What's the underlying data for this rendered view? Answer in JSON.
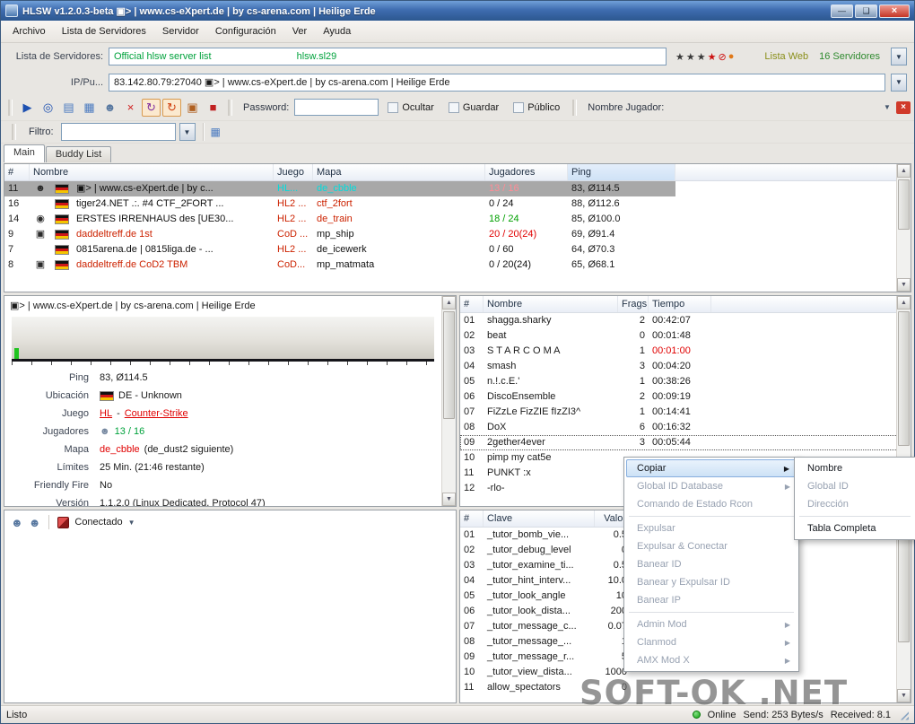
{
  "colors": {
    "accent_green": "#00a23c",
    "alert_red": "#e00000",
    "map_cyan": "#00dcdc",
    "selection_gray": "#a8a8a8",
    "header_blue": "#cfe2f6"
  },
  "window": {
    "title": "HLSW v1.2.0.3-beta   ▣> | www.cs-eXpert.de | by cs-arena.com | Heilige Erde",
    "controls": {
      "minimize": "—",
      "maximize": "❑",
      "close": "×"
    }
  },
  "menubar": {
    "items": [
      "Archivo",
      "Lista de Servidores",
      "Servidor",
      "Configuración",
      "Ver",
      "Ayuda"
    ]
  },
  "server_list_bar": {
    "label": "Lista de Servidores:",
    "list_name": "Official hlsw server list",
    "list_code": "hlsw.sl29",
    "icons": [
      {
        "name": "star-icon",
        "glyph": "★",
        "color": "#3a3a3a"
      },
      {
        "name": "star-icon",
        "glyph": "★",
        "color": "#3a3a3a"
      },
      {
        "name": "star-icon",
        "glyph": "★",
        "color": "#3a3a3a"
      },
      {
        "name": "red-star-icon",
        "glyph": "★",
        "color": "#cc1111"
      },
      {
        "name": "ban-icon",
        "glyph": "⊘",
        "color": "#cc1111"
      },
      {
        "name": "fireball-icon",
        "glyph": "●",
        "color": "#e07818"
      }
    ],
    "web_label": "Lista Web",
    "count_label": "16 Servidores"
  },
  "address_bar": {
    "label": "IP/Pu...",
    "value": "83.142.80.79:27040  ▣> | www.cs-eXpert.de | by cs-arena.com | Heilige Erde"
  },
  "toolbar": {
    "icons": [
      {
        "name": "connect-icon",
        "glyph": "▶",
        "color": "#1d50b0"
      },
      {
        "name": "search-server-icon",
        "glyph": "◎",
        "color": "#1d50b0"
      },
      {
        "name": "server-window-icon",
        "glyph": "▤",
        "color": "#4a7ac0"
      },
      {
        "name": "server-list-icon",
        "glyph": "▦",
        "color": "#4a7ac0"
      },
      {
        "name": "players-icon",
        "glyph": "☻",
        "color": "#5878a0"
      },
      {
        "name": "delete-icon",
        "glyph": "×",
        "color": "#d02020"
      },
      {
        "name": "refresh-all-icon",
        "glyph": "↻",
        "color": "#8030a0",
        "toggled": true
      },
      {
        "name": "refresh-server-icon",
        "glyph": "↻",
        "color": "#d04010",
        "toggled": true
      },
      {
        "name": "rcon-icon",
        "glyph": "▣",
        "color": "#b06020"
      },
      {
        "name": "stop-icon",
        "glyph": "■",
        "color": "#c02020"
      }
    ],
    "password_label": "Password:",
    "password_value": "",
    "checkboxes": [
      {
        "label": "Ocultar",
        "checked": false
      },
      {
        "label": "Guardar",
        "checked": false
      },
      {
        "label": "Público",
        "checked": false
      }
    ],
    "player_label": "Nombre Jugador:"
  },
  "filter_bar": {
    "label": "Filtro:",
    "value": ""
  },
  "tabs": [
    {
      "label": "Main",
      "active": true
    },
    {
      "label": "Buddy List",
      "active": false
    }
  ],
  "server_table": {
    "header": {
      "num": "#",
      "name": "Nombre",
      "game": "Juego",
      "map": "Mapa",
      "players": "Jugadores",
      "ping": "Ping"
    },
    "sorted_column": "Ping",
    "rows": [
      {
        "num": "11",
        "icon": "☻",
        "name": "▣> | www.cs-eXpert.de | by c...",
        "name_color": "#101010",
        "game": "HL...",
        "game_color": "#00dcdc",
        "map": "de_cbble",
        "map_color": "#00dcdc",
        "players": "13 / 16",
        "players_color": "#ff8c96",
        "ping": "83, Ø114.5",
        "selected": true
      },
      {
        "num": "16",
        "icon": "",
        "name": "tiger24.NET .:. #4 CTF_2FORT ...",
        "name_color": "#101010",
        "game": "HL2 ...",
        "game_color": "#cc2200",
        "map": "ctf_2fort",
        "map_color": "#cc2200",
        "players": "0 / 24",
        "players_color": "#101010",
        "ping": "88, Ø112.6"
      },
      {
        "num": "14",
        "icon": "◉",
        "name": "ERSTES IRRENHAUS des [UE30...",
        "name_color": "#101010",
        "game": "HL2 ...",
        "game_color": "#cc2200",
        "map": "de_train",
        "map_color": "#cc2200",
        "players": "18 / 24",
        "players_color": "#00a000",
        "ping": "85, Ø100.0"
      },
      {
        "num": "9",
        "icon": "▣",
        "name": "daddeltreff.de 1st",
        "name_color": "#cc2200",
        "game": "CoD ...",
        "game_color": "#cc2200",
        "map": "mp_ship",
        "map_color": "#101010",
        "players": "20 / 20(24)",
        "players_color": "#e00000",
        "ping": "69, Ø91.4"
      },
      {
        "num": "7",
        "icon": "",
        "name": "0815arena.de | 0815liga.de - ...",
        "name_color": "#101010",
        "game": "HL2 ...",
        "game_color": "#cc2200",
        "map": "de_icewerk",
        "map_color": "#101010",
        "players": "0 / 60",
        "players_color": "#101010",
        "ping": "64, Ø70.3"
      },
      {
        "num": "8",
        "icon": "▣",
        "name": "daddeltreff.de CoD2 TBM",
        "name_color": "#cc2200",
        "game": "CoD...",
        "game_color": "#cc2200",
        "map": "mp_matmata",
        "map_color": "#101010",
        "players": "0 / 20(24)",
        "players_color": "#101010",
        "ping": "65, Ø68.1"
      }
    ]
  },
  "info_panel": {
    "title": "▣> | www.cs-eXpert.de | by cs-arena.com | Heilige Erde",
    "fields": {
      "ping": {
        "label": "Ping",
        "value": "83, Ø114.5"
      },
      "location": {
        "label": "Ubicación",
        "value": "DE - Unknown"
      },
      "game": {
        "label": "Juego",
        "game_link": "HL",
        "separator": "-",
        "mod_link": "Counter-Strike"
      },
      "players": {
        "label": "Jugadores",
        "value": "13 / 16"
      },
      "map": {
        "label": "Mapa",
        "current": "de_cbble",
        "next": "(de_dust2 siguiente)"
      },
      "limits": {
        "label": "Límites",
        "value": "25 Min. (21:46 restante)"
      },
      "friendly_fire": {
        "label": "Friendly Fire",
        "value": "No"
      },
      "version": {
        "label": "Versión",
        "value": "1.1.2.0 (Linux Dedicated, Protocol 47)"
      }
    }
  },
  "connection_panel": {
    "status_label": "Conectado"
  },
  "players_panel": {
    "header": {
      "num": "#",
      "name": "Nombre",
      "frags": "Frags",
      "time": "Tiempo"
    },
    "rows": [
      {
        "num": "01",
        "name": "shagga.sharky",
        "frags": "2",
        "time": "00:42:07"
      },
      {
        "num": "02",
        "name": "beat",
        "frags": "0",
        "time": "00:01:48"
      },
      {
        "num": "03",
        "name": "S T A R C O M A",
        "frags": "1",
        "time": "00:01:00",
        "time_color": "#e00000"
      },
      {
        "num": "04",
        "name": "smash",
        "frags": "3",
        "time": "00:04:20"
      },
      {
        "num": "05",
        "name": "n.!.c.E.'",
        "frags": "1",
        "time": "00:38:26"
      },
      {
        "num": "06",
        "name": "DiscoEnsemble",
        "frags": "2",
        "time": "00:09:19"
      },
      {
        "num": "07",
        "name": "FiZzLe FizZIE fIzZI3^",
        "frags": "1",
        "time": "00:14:41"
      },
      {
        "num": "08",
        "name": "DoX",
        "frags": "6",
        "time": "00:16:32"
      },
      {
        "num": "09",
        "name": "2gether4ever",
        "frags": "3",
        "time": "00:05:44",
        "selected": true
      },
      {
        "num": "10",
        "name": "pimp my cat5e"
      },
      {
        "num": "11",
        "name": "PUNKT :x"
      },
      {
        "num": "12",
        "name": "-rlo-"
      }
    ]
  },
  "rules_panel": {
    "header": {
      "num": "#",
      "key": "Clave",
      "value": "Valor"
    },
    "rows": [
      {
        "num": "01",
        "key": "_tutor_bomb_vie...",
        "value": "0.5"
      },
      {
        "num": "02",
        "key": "_tutor_debug_level",
        "value": "0"
      },
      {
        "num": "03",
        "key": "_tutor_examine_ti...",
        "value": "0.5"
      },
      {
        "num": "04",
        "key": "_tutor_hint_interv...",
        "value": "10.0"
      },
      {
        "num": "05",
        "key": "_tutor_look_angle",
        "value": "10"
      },
      {
        "num": "06",
        "key": "_tutor_look_dista...",
        "value": "200"
      },
      {
        "num": "07",
        "key": "_tutor_message_c...",
        "value": "0.07"
      },
      {
        "num": "08",
        "key": "_tutor_message_...",
        "value": "1"
      },
      {
        "num": "09",
        "key": "_tutor_message_r...",
        "value": "5"
      },
      {
        "num": "10",
        "key": "_tutor_view_dista...",
        "value": "1000"
      },
      {
        "num": "11",
        "key": "allow_spectators",
        "value": "0"
      }
    ]
  },
  "context_menu": {
    "items": [
      {
        "label": "Copiar",
        "submenu": true,
        "highlighted": true
      },
      {
        "label": "Global ID Database",
        "submenu": true,
        "disabled": true
      },
      {
        "label": "Comando de Estado Rcon",
        "disabled": true
      },
      {
        "separator": true
      },
      {
        "label": "Expulsar",
        "disabled": true
      },
      {
        "label": "Expulsar & Conectar",
        "disabled": true
      },
      {
        "label": "Banear ID",
        "disabled": true
      },
      {
        "label": "Banear y Expulsar ID",
        "disabled": true
      },
      {
        "label": "Banear IP",
        "disabled": true
      },
      {
        "separator": true
      },
      {
        "label": "Admin Mod",
        "submenu": true,
        "disabled": true
      },
      {
        "label": "Clanmod",
        "submenu": true,
        "disabled": true
      },
      {
        "label": "AMX Mod X",
        "submenu": true,
        "disabled": true
      }
    ],
    "submenu_items": [
      {
        "label": "Nombre"
      },
      {
        "label": "Global ID",
        "disabled": true
      },
      {
        "label": "Dirección",
        "disabled": true
      },
      {
        "separator": true
      },
      {
        "label": "Tabla Completa"
      }
    ]
  },
  "status_bar": {
    "ready": "Listo",
    "online_label": "Online",
    "send": "Send: 253 Bytes/s",
    "received": "Received: 8.1"
  },
  "watermark": {
    "text": "SOFT-OK .NET"
  }
}
